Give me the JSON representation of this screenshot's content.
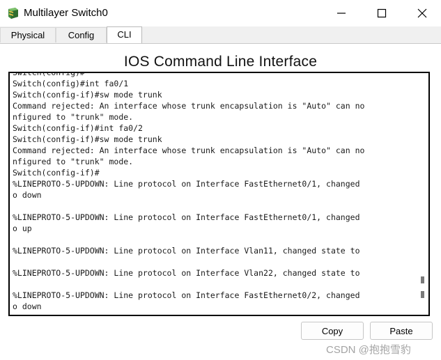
{
  "window": {
    "title": "Multilayer Switch0",
    "icon": "switch-device-icon"
  },
  "tabs": [
    {
      "label": "Physical",
      "active": false
    },
    {
      "label": "Config",
      "active": false
    },
    {
      "label": "CLI",
      "active": true
    }
  ],
  "cli": {
    "heading": "IOS Command Line Interface",
    "lines": [
      "Switch(config)#",
      "Switch(config)#int fa0/1",
      "Switch(config-if)#sw mode trunk",
      "Command rejected: An interface whose trunk encapsulation is \"Auto\" can no",
      "nfigured to \"trunk\" mode.",
      "Switch(config-if)#int fa0/2",
      "Switch(config-if)#sw mode trunk",
      "Command rejected: An interface whose trunk encapsulation is \"Auto\" can no",
      "nfigured to \"trunk\" mode.",
      "Switch(config-if)#",
      "%LINEPROTO-5-UPDOWN: Line protocol on Interface FastEthernet0/1, changed",
      "o down",
      "",
      "%LINEPROTO-5-UPDOWN: Line protocol on Interface FastEthernet0/1, changed",
      "o up",
      "",
      "%LINEPROTO-5-UPDOWN: Line protocol on Interface Vlan11, changed state to",
      "",
      "%LINEPROTO-5-UPDOWN: Line protocol on Interface Vlan22, changed state to",
      "",
      "%LINEPROTO-5-UPDOWN: Line protocol on Interface FastEthernet0/2, changed",
      "o down"
    ]
  },
  "buttons": {
    "copy": "Copy",
    "paste": "Paste"
  },
  "watermark": "CSDN @抱抱雪豹"
}
